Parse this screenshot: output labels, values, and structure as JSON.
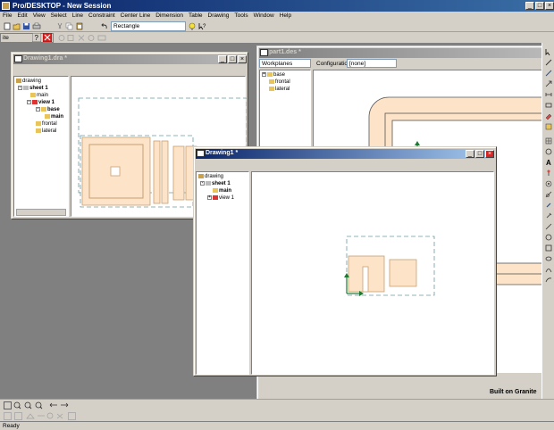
{
  "app": {
    "title": "Pro/DESKTOP - New Session"
  },
  "menu": [
    "File",
    "Edit",
    "View",
    "Select",
    "Line",
    "Constraint",
    "Center Line",
    "Dimension",
    "Table",
    "Drawing",
    "Tools",
    "Window",
    "Help"
  ],
  "toolbar": {
    "tool_combo": "Rectangle"
  },
  "toolbar2": {
    "left_field": "ite"
  },
  "window_drawing_dra": {
    "title": "Drawing1.dra *",
    "tree": [
      "drawing",
      "sheet 1",
      "main",
      "view 1",
      "base",
      "main",
      "frontal",
      "lateral"
    ]
  },
  "window_part": {
    "title": "part1.des *",
    "workplanes_combo": "Workplanes",
    "configuration_label": "Configuration:",
    "configuration_combo": "[none]",
    "tree": [
      "base",
      "frontal",
      "lateral"
    ]
  },
  "window_drawing_active": {
    "title": "Drawing1 *",
    "tree": [
      "drawing",
      "sheet 1",
      "main",
      "view 1"
    ]
  },
  "status": {
    "text": "Ready",
    "brand": "Built on Granite"
  },
  "colors": {
    "accent": "#0a246a",
    "part_fill": "#fde3c8",
    "part_stroke": "#c8a070",
    "axis_green": "#1d7a33"
  }
}
